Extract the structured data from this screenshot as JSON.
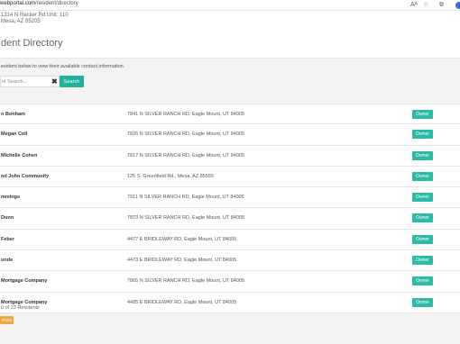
{
  "browser": {
    "url_host": "webportal.com",
    "url_path": "/resident/directory",
    "icons": [
      "read-aloud-icon",
      "favorites-icon",
      "extensions-icon",
      "profile-icon"
    ]
  },
  "header": {
    "address_line1": "1314 N Recker Rd Unit: 110",
    "address_line2": "Mesa, AZ 85205",
    "title": "dent Directory"
  },
  "search": {
    "intro": "esident below to view their available contact information.",
    "placeholder": "nt Search...",
    "clear_glyph": "✖",
    "button_label": "Search"
  },
  "residents": [
    {
      "name": "n Bonham",
      "address": "7841 N SILVER RANCH RD, Eagle Mount, UT 84005",
      "role": "Owner"
    },
    {
      "name": "Megan Coll",
      "address": "7826 N SILVER RANCH RD, Eagle Mount, UT 84005",
      "role": "Owner"
    },
    {
      "name": "Michelle Cohen",
      "address": "7817 N SILVER RANCH RD, Eagle Mount, UT 84005",
      "role": "Owner"
    },
    {
      "name": "nd John Community",
      "address": "125 S. Greenfield Rd., Mesa, AZ 85555",
      "role": "Owner"
    },
    {
      "name": "mmings",
      "address": "7911 N SILVER RANCH RD, Eagle Mount, UT 84005",
      "role": "Owner"
    },
    {
      "name": "Dunn",
      "address": "7873 N SILVER RANCH RD, Eagle Mount, UT 84005",
      "role": "Owner"
    },
    {
      "name": "Feber",
      "address": "4477 E BRIDLEWAY RD, Eagle Mount, UT 84005",
      "role": "Owner"
    },
    {
      "name": "unde",
      "address": "4473 E BRIDLEWAY RD, Eagle Mount, UT 84005",
      "role": "Owner"
    },
    {
      "name": "Mortgage Company",
      "address": "7865 N SILVER RANCH RD, Eagle Mount, UT 84005",
      "role": "Owner"
    },
    {
      "name": "Mortgage Company",
      "address": "4485 E BRIDLEWAY RD, Eagle Mount, UT 84005",
      "role": "Owner"
    }
  ],
  "footer": {
    "count_text": "0 of 23 Residents",
    "more_label": "more"
  },
  "colors": {
    "accent": "#24b19a",
    "owner_badge": "#2dbba3",
    "more_button": "#f0a63a",
    "profile": "#3b6fd8"
  }
}
